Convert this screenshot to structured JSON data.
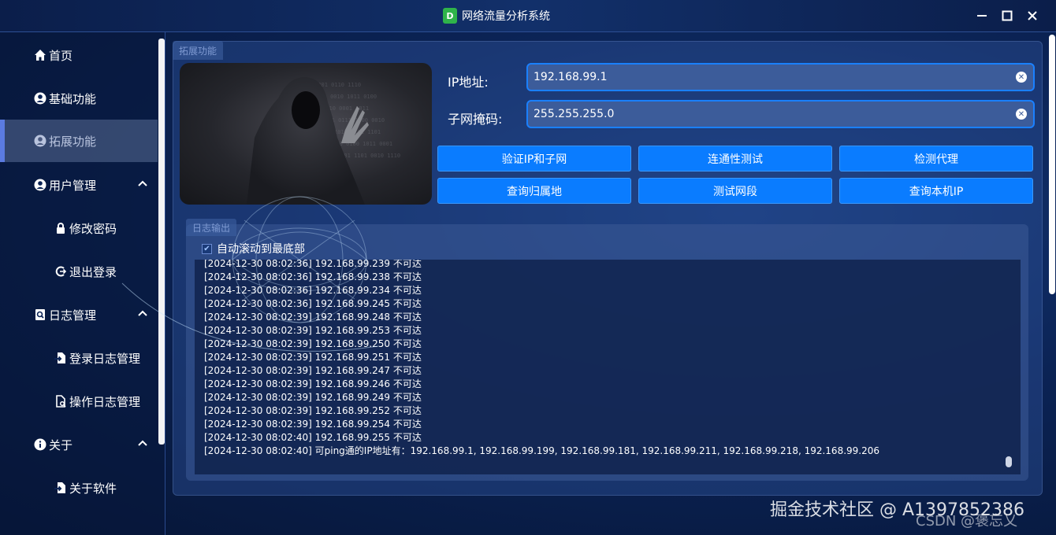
{
  "window": {
    "title": "网络流量分析系统",
    "app_icon_letter": "D",
    "controls": {
      "minimize": "—",
      "maximize": "☐",
      "close": "✕"
    }
  },
  "sidebar": {
    "items": [
      {
        "label": "首页",
        "icon": "home-icon"
      },
      {
        "label": "基础功能",
        "icon": "user-circle-icon"
      },
      {
        "label": "拓展功能",
        "icon": "user-circle-icon",
        "active": true
      },
      {
        "label": "用户管理",
        "icon": "user-circle-icon",
        "expandable": true
      },
      {
        "label": "修改密码",
        "icon": "lock-icon",
        "sub": true
      },
      {
        "label": "退出登录",
        "icon": "logout-icon",
        "sub": true
      },
      {
        "label": "日志管理",
        "icon": "log-search-icon",
        "expandable": true
      },
      {
        "label": "登录日志管理",
        "icon": "file-import-icon",
        "sub": true
      },
      {
        "label": "操作日志管理",
        "icon": "file-search-icon",
        "sub": true
      },
      {
        "label": "关于",
        "icon": "info-icon",
        "expandable": true
      },
      {
        "label": "关于软件",
        "icon": "file-import-icon",
        "sub": true
      }
    ]
  },
  "main": {
    "panel_title": "拓展功能",
    "ip_label": "IP地址:",
    "ip_value": "192.168.99.1",
    "mask_label": "子网掩码:",
    "mask_value": "255.255.255.0",
    "buttons": [
      "验证IP和子网",
      "连通性测试",
      "检测代理",
      "查询归属地",
      "测试网段",
      "查询本机IP"
    ]
  },
  "log": {
    "title": "日志输出",
    "autoscroll_label": "自动滚动到最底部",
    "autoscroll_checked": true,
    "lines": [
      "[2024-12-30 08:02:36] 192.168.99.239 不可达",
      "[2024-12-30 08:02:36] 192.168.99.238 不可达",
      "[2024-12-30 08:02:36] 192.168.99.234 不可达",
      "[2024-12-30 08:02:36] 192.168.99.245 不可达",
      "[2024-12-30 08:02:39] 192.168.99.248 不可达",
      "[2024-12-30 08:02:39] 192.168.99.253 不可达",
      "[2024-12-30 08:02:39] 192.168.99.250 不可达",
      "[2024-12-30 08:02:39] 192.168.99.251 不可达",
      "[2024-12-30 08:02:39] 192.168.99.247 不可达",
      "[2024-12-30 08:02:39] 192.168.99.246 不可达",
      "[2024-12-30 08:02:39] 192.168.99.249 不可达",
      "[2024-12-30 08:02:39] 192.168.99.252 不可达",
      "[2024-12-30 08:02:39] 192.168.99.254 不可达",
      "[2024-12-30 08:02:40] 192.168.99.255 不可达",
      "[2024-12-30 08:02:40] 可ping通的IP地址有：192.168.99.1, 192.168.99.199, 192.168.99.181, 192.168.99.211, 192.168.99.218, 192.168.99.206"
    ]
  },
  "watermark": {
    "primary": "掘金技术社区 @ A1397852386",
    "secondary": "CSDN @褒忘乂"
  },
  "colors": {
    "accent": "#0a7cff",
    "input_border": "#1a80ff",
    "background": "#0b2355"
  }
}
